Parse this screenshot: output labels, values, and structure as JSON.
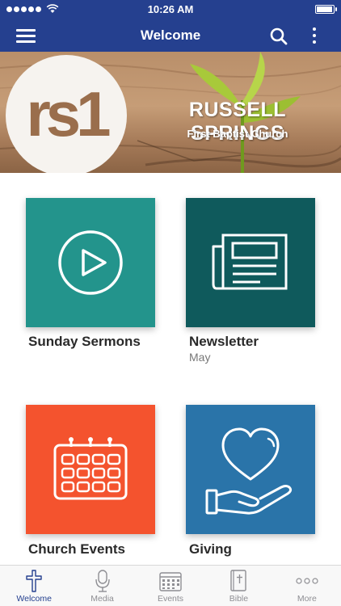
{
  "status_bar": {
    "time": "10:26 AM",
    "battery_level": 1.0
  },
  "nav": {
    "title": "Welcome",
    "menu_icon": "hamburger-menu-icon",
    "search_icon": "search-icon",
    "more_icon": "vertical-ellipsis-icon"
  },
  "banner": {
    "logo_text": "rs1",
    "church_name": "RUSSELL SPRINGS",
    "church_subtitle": "First Baptist Church"
  },
  "tiles": [
    {
      "label": "Sunday Sermons",
      "subtitle": "",
      "icon": "play-circle-icon",
      "color": "#23948c"
    },
    {
      "label": "Newsletter",
      "subtitle": "May",
      "icon": "newspaper-icon",
      "color": "#0f5a5c"
    },
    {
      "label": "Church Events",
      "subtitle": "",
      "icon": "calendar-icon",
      "color": "#f4532e"
    },
    {
      "label": "Giving",
      "subtitle": "",
      "icon": "heart-in-hand-icon",
      "color": "#2a74a9"
    }
  ],
  "tab_bar": {
    "items": [
      {
        "label": "Welcome",
        "icon": "cross-icon",
        "active": true
      },
      {
        "label": "Media",
        "icon": "microphone-icon",
        "active": false
      },
      {
        "label": "Events",
        "icon": "calendar-icon",
        "active": false
      },
      {
        "label": "Bible",
        "icon": "bible-icon",
        "active": false
      },
      {
        "label": "More",
        "icon": "more-dots-icon",
        "active": false
      }
    ]
  },
  "colors": {
    "brand_blue": "#25408f",
    "inactive_gray": "#8e8e93"
  }
}
